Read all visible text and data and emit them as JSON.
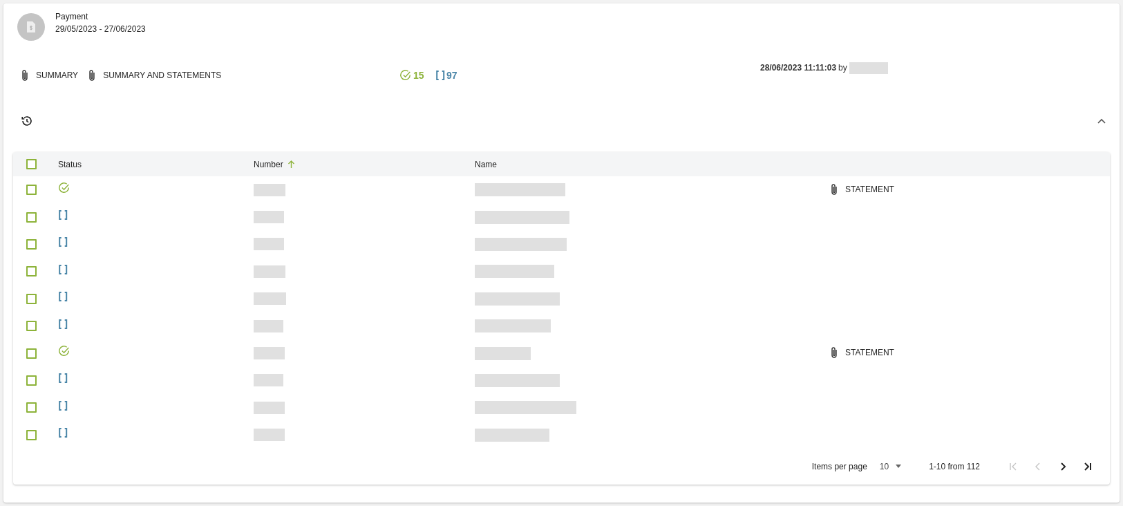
{
  "header": {
    "title": "Payment",
    "period": "29/05/2023 - 27/06/2023"
  },
  "attachments": [
    {
      "label": "SUMMARY"
    },
    {
      "label": "SUMMARY AND STATEMENTS"
    }
  ],
  "counts": [
    {
      "kind": "done",
      "value": "15"
    },
    {
      "kind": "pending",
      "value": "97"
    }
  ],
  "updated": {
    "timestamp": "28/06/2023 11:11:03",
    "by": "by"
  },
  "panel": {
    "expanded": true
  },
  "table": {
    "select_all": {
      "checked": false
    },
    "columns": [
      {
        "label": "Status",
        "sorted": false
      },
      {
        "label": "Number",
        "sorted": true
      },
      {
        "label": "Name",
        "sorted": false
      }
    ],
    "rows": [
      {
        "kind": "done",
        "checked": false,
        "attachment": "STATEMENT"
      },
      {
        "kind": "pending",
        "checked": false
      },
      {
        "kind": "pending",
        "checked": false
      },
      {
        "kind": "pending",
        "checked": false
      },
      {
        "kind": "pending",
        "checked": false
      },
      {
        "kind": "pending",
        "checked": false
      },
      {
        "kind": "done",
        "checked": false,
        "attachment": "STATEMENT"
      },
      {
        "kind": "pending",
        "checked": false
      },
      {
        "kind": "pending",
        "checked": false
      },
      {
        "kind": "pending",
        "checked": false
      }
    ]
  },
  "pagination": {
    "label": "Items per page",
    "page_size": "10",
    "range": "1-10 from 112",
    "first_disabled": true,
    "prev_disabled": true,
    "next_disabled": false,
    "last_disabled": false
  }
}
